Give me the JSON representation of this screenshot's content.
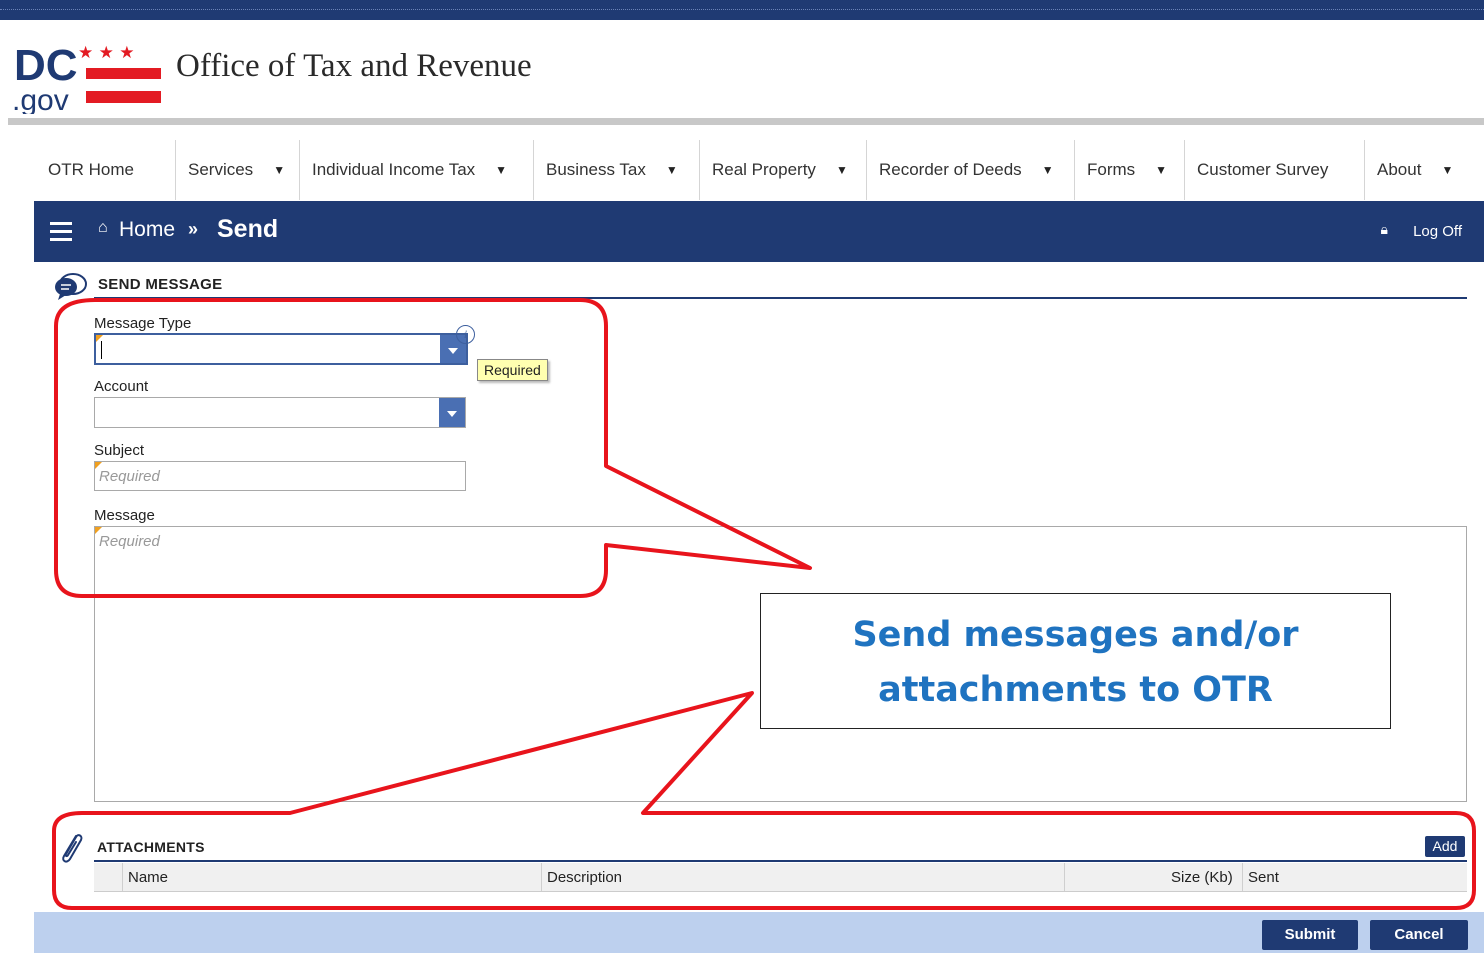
{
  "brand": {
    "logo_text_top": "DC",
    "logo_text_bottom": ".gov",
    "title": "Office of Tax and Revenue"
  },
  "nav": {
    "items": [
      {
        "label": "OTR Home",
        "has_dropdown": false
      },
      {
        "label": "Services",
        "has_dropdown": true
      },
      {
        "label": "Individual Income Tax",
        "has_dropdown": true
      },
      {
        "label": "Business Tax",
        "has_dropdown": true
      },
      {
        "label": "Real Property",
        "has_dropdown": true
      },
      {
        "label": "Recorder of Deeds",
        "has_dropdown": true
      },
      {
        "label": "Forms",
        "has_dropdown": true
      },
      {
        "label": "Customer Survey",
        "has_dropdown": false
      },
      {
        "label": "About",
        "has_dropdown": true
      }
    ]
  },
  "breadcrumb": {
    "home_label": "Home",
    "separator": "»",
    "current": "Send"
  },
  "header": {
    "logoff_label": "Log Off"
  },
  "send_message": {
    "section_title": "SEND MESSAGE",
    "fields": {
      "message_type": {
        "label": "Message Type",
        "value": "",
        "tooltip": "Required"
      },
      "account": {
        "label": "Account",
        "value": ""
      },
      "subject": {
        "label": "Subject",
        "placeholder": "Required"
      },
      "message": {
        "label": "Message",
        "placeholder": "Required"
      }
    }
  },
  "callout": {
    "line1": "Send messages and/or",
    "line2": "attachments to OTR"
  },
  "attachments": {
    "section_title": "ATTACHMENTS",
    "add_label": "Add",
    "columns": [
      "Name",
      "Description",
      "Size (Kb)",
      "Sent"
    ]
  },
  "footer": {
    "submit_label": "Submit",
    "cancel_label": "Cancel"
  },
  "colors": {
    "primary_navy": "#1f3a73",
    "footer_bar": "#bdd0ee",
    "callout_text": "#1f73c0",
    "highlight_red": "#e8141c",
    "dc_flag_red": "#e31b23"
  }
}
